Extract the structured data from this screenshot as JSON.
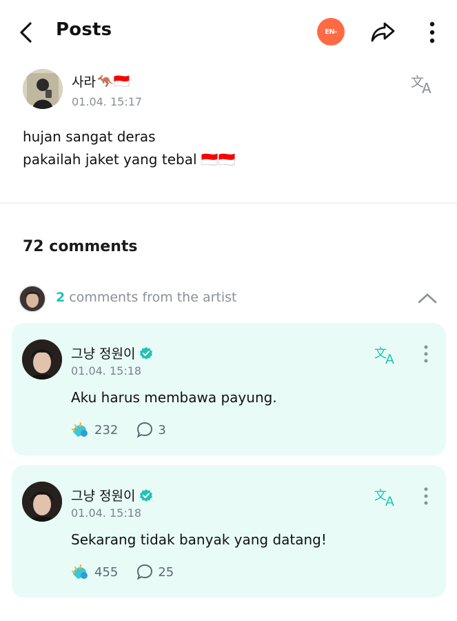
{
  "header": {
    "title": "Posts",
    "community_badge": "EN-"
  },
  "post": {
    "author": "사라",
    "author_emojis": "🦘🇮🇩",
    "time": "01.04. 15:17",
    "body_line1": "hujan sangat deras",
    "body_line2": "pakailah jaket yang tebal 🇮🇩🇮🇩"
  },
  "comments_section": {
    "count_label": "72 comments",
    "artist_count": "2",
    "artist_label": " comments from the artist"
  },
  "comments": [
    {
      "name": "그냥 정원이",
      "time": "01.04. 15:18",
      "text": "Aku harus membawa payung.",
      "likes": "232",
      "replies": "3"
    },
    {
      "name": "그냥 정원이",
      "time": "01.04. 15:18",
      "text": "Sekarang tidak banyak yang datang!",
      "likes": "455",
      "replies": "25"
    }
  ],
  "colors": {
    "accent": "#20c3b4",
    "card_bg": "#e8fbf7",
    "badge": "#ff6a45",
    "muted": "#8a9098"
  },
  "icons": {
    "back": "chevron-left-icon",
    "share": "share-arrow-icon",
    "more": "more-vertical-icon",
    "translate": "translate-icon",
    "verified": "verified-badge-icon",
    "like": "weverse-like-icon",
    "reply": "comment-bubble-icon",
    "collapse": "chevron-up-icon"
  }
}
